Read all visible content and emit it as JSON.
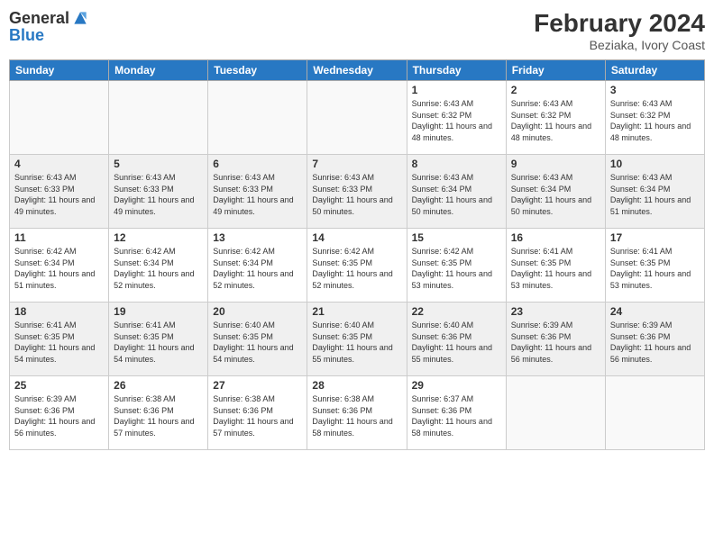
{
  "header": {
    "logo_general": "General",
    "logo_blue": "Blue",
    "month_year": "February 2024",
    "location": "Beziaka, Ivory Coast"
  },
  "weekdays": [
    "Sunday",
    "Monday",
    "Tuesday",
    "Wednesday",
    "Thursday",
    "Friday",
    "Saturday"
  ],
  "weeks": [
    [
      {
        "day": "",
        "info": ""
      },
      {
        "day": "",
        "info": ""
      },
      {
        "day": "",
        "info": ""
      },
      {
        "day": "",
        "info": ""
      },
      {
        "day": "1",
        "info": "Sunrise: 6:43 AM\nSunset: 6:32 PM\nDaylight: 11 hours and 48 minutes."
      },
      {
        "day": "2",
        "info": "Sunrise: 6:43 AM\nSunset: 6:32 PM\nDaylight: 11 hours and 48 minutes."
      },
      {
        "day": "3",
        "info": "Sunrise: 6:43 AM\nSunset: 6:32 PM\nDaylight: 11 hours and 48 minutes."
      }
    ],
    [
      {
        "day": "4",
        "info": "Sunrise: 6:43 AM\nSunset: 6:33 PM\nDaylight: 11 hours and 49 minutes."
      },
      {
        "day": "5",
        "info": "Sunrise: 6:43 AM\nSunset: 6:33 PM\nDaylight: 11 hours and 49 minutes."
      },
      {
        "day": "6",
        "info": "Sunrise: 6:43 AM\nSunset: 6:33 PM\nDaylight: 11 hours and 49 minutes."
      },
      {
        "day": "7",
        "info": "Sunrise: 6:43 AM\nSunset: 6:33 PM\nDaylight: 11 hours and 50 minutes."
      },
      {
        "day": "8",
        "info": "Sunrise: 6:43 AM\nSunset: 6:34 PM\nDaylight: 11 hours and 50 minutes."
      },
      {
        "day": "9",
        "info": "Sunrise: 6:43 AM\nSunset: 6:34 PM\nDaylight: 11 hours and 50 minutes."
      },
      {
        "day": "10",
        "info": "Sunrise: 6:43 AM\nSunset: 6:34 PM\nDaylight: 11 hours and 51 minutes."
      }
    ],
    [
      {
        "day": "11",
        "info": "Sunrise: 6:42 AM\nSunset: 6:34 PM\nDaylight: 11 hours and 51 minutes."
      },
      {
        "day": "12",
        "info": "Sunrise: 6:42 AM\nSunset: 6:34 PM\nDaylight: 11 hours and 52 minutes."
      },
      {
        "day": "13",
        "info": "Sunrise: 6:42 AM\nSunset: 6:34 PM\nDaylight: 11 hours and 52 minutes."
      },
      {
        "day": "14",
        "info": "Sunrise: 6:42 AM\nSunset: 6:35 PM\nDaylight: 11 hours and 52 minutes."
      },
      {
        "day": "15",
        "info": "Sunrise: 6:42 AM\nSunset: 6:35 PM\nDaylight: 11 hours and 53 minutes."
      },
      {
        "day": "16",
        "info": "Sunrise: 6:41 AM\nSunset: 6:35 PM\nDaylight: 11 hours and 53 minutes."
      },
      {
        "day": "17",
        "info": "Sunrise: 6:41 AM\nSunset: 6:35 PM\nDaylight: 11 hours and 53 minutes."
      }
    ],
    [
      {
        "day": "18",
        "info": "Sunrise: 6:41 AM\nSunset: 6:35 PM\nDaylight: 11 hours and 54 minutes."
      },
      {
        "day": "19",
        "info": "Sunrise: 6:41 AM\nSunset: 6:35 PM\nDaylight: 11 hours and 54 minutes."
      },
      {
        "day": "20",
        "info": "Sunrise: 6:40 AM\nSunset: 6:35 PM\nDaylight: 11 hours and 54 minutes."
      },
      {
        "day": "21",
        "info": "Sunrise: 6:40 AM\nSunset: 6:35 PM\nDaylight: 11 hours and 55 minutes."
      },
      {
        "day": "22",
        "info": "Sunrise: 6:40 AM\nSunset: 6:36 PM\nDaylight: 11 hours and 55 minutes."
      },
      {
        "day": "23",
        "info": "Sunrise: 6:39 AM\nSunset: 6:36 PM\nDaylight: 11 hours and 56 minutes."
      },
      {
        "day": "24",
        "info": "Sunrise: 6:39 AM\nSunset: 6:36 PM\nDaylight: 11 hours and 56 minutes."
      }
    ],
    [
      {
        "day": "25",
        "info": "Sunrise: 6:39 AM\nSunset: 6:36 PM\nDaylight: 11 hours and 56 minutes."
      },
      {
        "day": "26",
        "info": "Sunrise: 6:38 AM\nSunset: 6:36 PM\nDaylight: 11 hours and 57 minutes."
      },
      {
        "day": "27",
        "info": "Sunrise: 6:38 AM\nSunset: 6:36 PM\nDaylight: 11 hours and 57 minutes."
      },
      {
        "day": "28",
        "info": "Sunrise: 6:38 AM\nSunset: 6:36 PM\nDaylight: 11 hours and 58 minutes."
      },
      {
        "day": "29",
        "info": "Sunrise: 6:37 AM\nSunset: 6:36 PM\nDaylight: 11 hours and 58 minutes."
      },
      {
        "day": "",
        "info": ""
      },
      {
        "day": "",
        "info": ""
      }
    ]
  ]
}
